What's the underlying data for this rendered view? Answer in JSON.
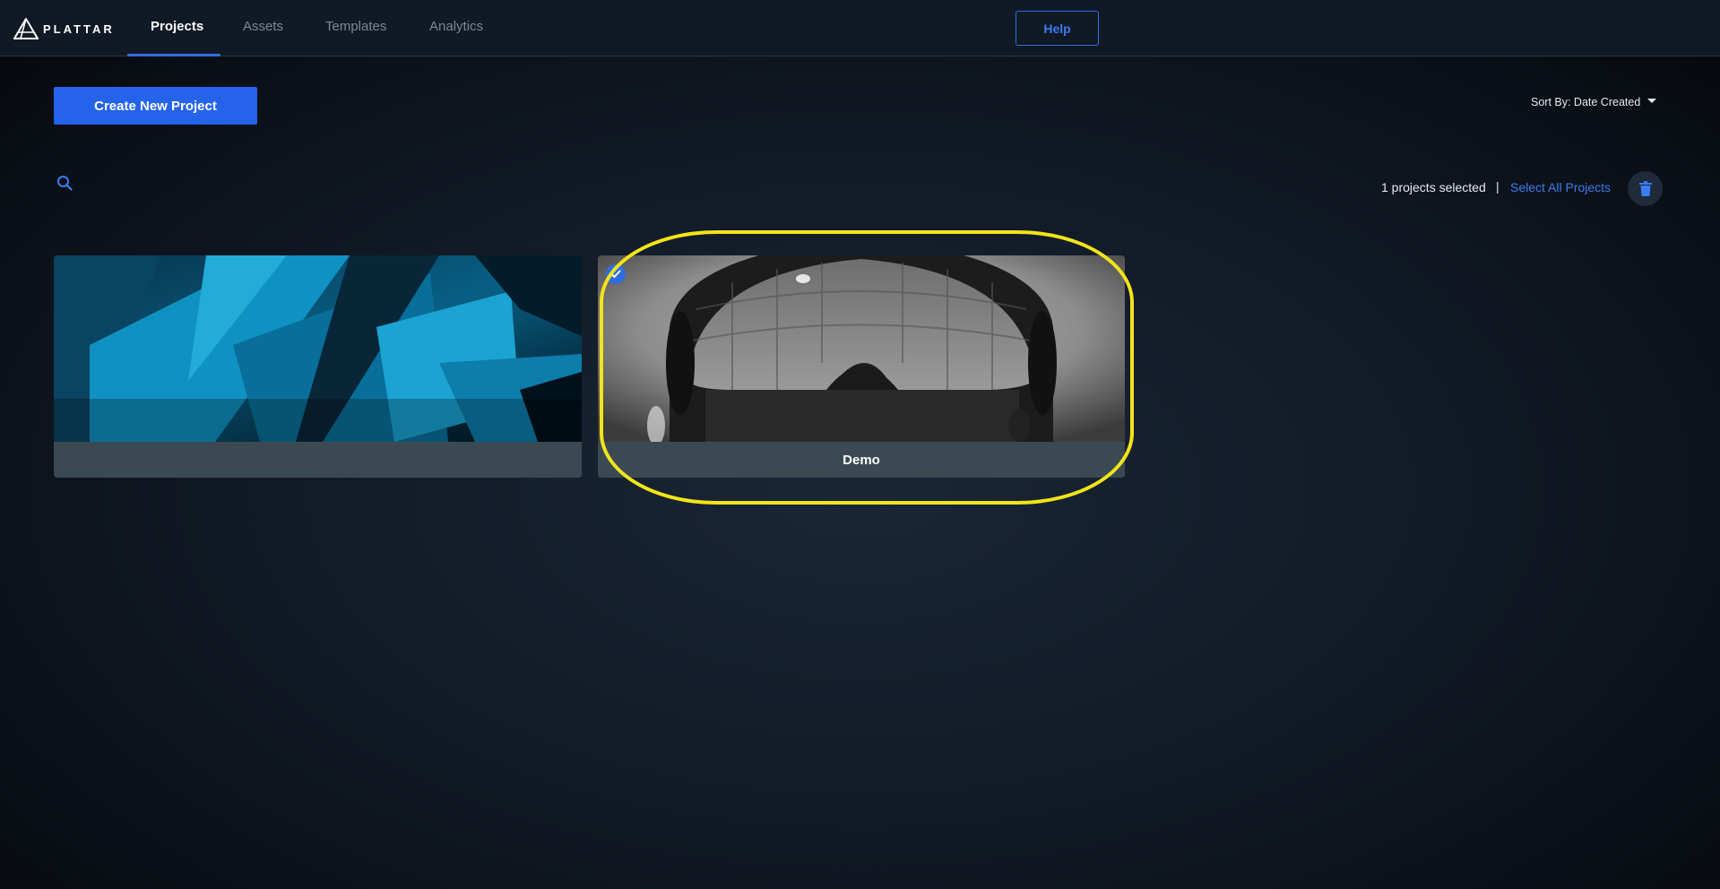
{
  "app": {
    "brand": "PLATTAR"
  },
  "nav": {
    "tabs": [
      {
        "label": "Projects",
        "active": true
      },
      {
        "label": "Assets",
        "active": false
      },
      {
        "label": "Templates",
        "active": false
      },
      {
        "label": "Analytics",
        "active": false
      }
    ],
    "help_label": "Help"
  },
  "toolbar": {
    "create_label": "Create New Project",
    "sort_label": "Sort By: Date Created"
  },
  "selection": {
    "count_text": "1 projects selected",
    "separator": "|",
    "select_all_label": "Select All Projects"
  },
  "projects": [
    {
      "name": "",
      "selected": false,
      "thumbnail": "abstract-blue-polygons"
    },
    {
      "name": "Demo",
      "selected": true,
      "thumbnail": "vr-headset-interior"
    }
  ],
  "colors": {
    "accent": "#2563eb",
    "highlight": "#f2e41a",
    "caption_bg": "#3b4a52"
  }
}
